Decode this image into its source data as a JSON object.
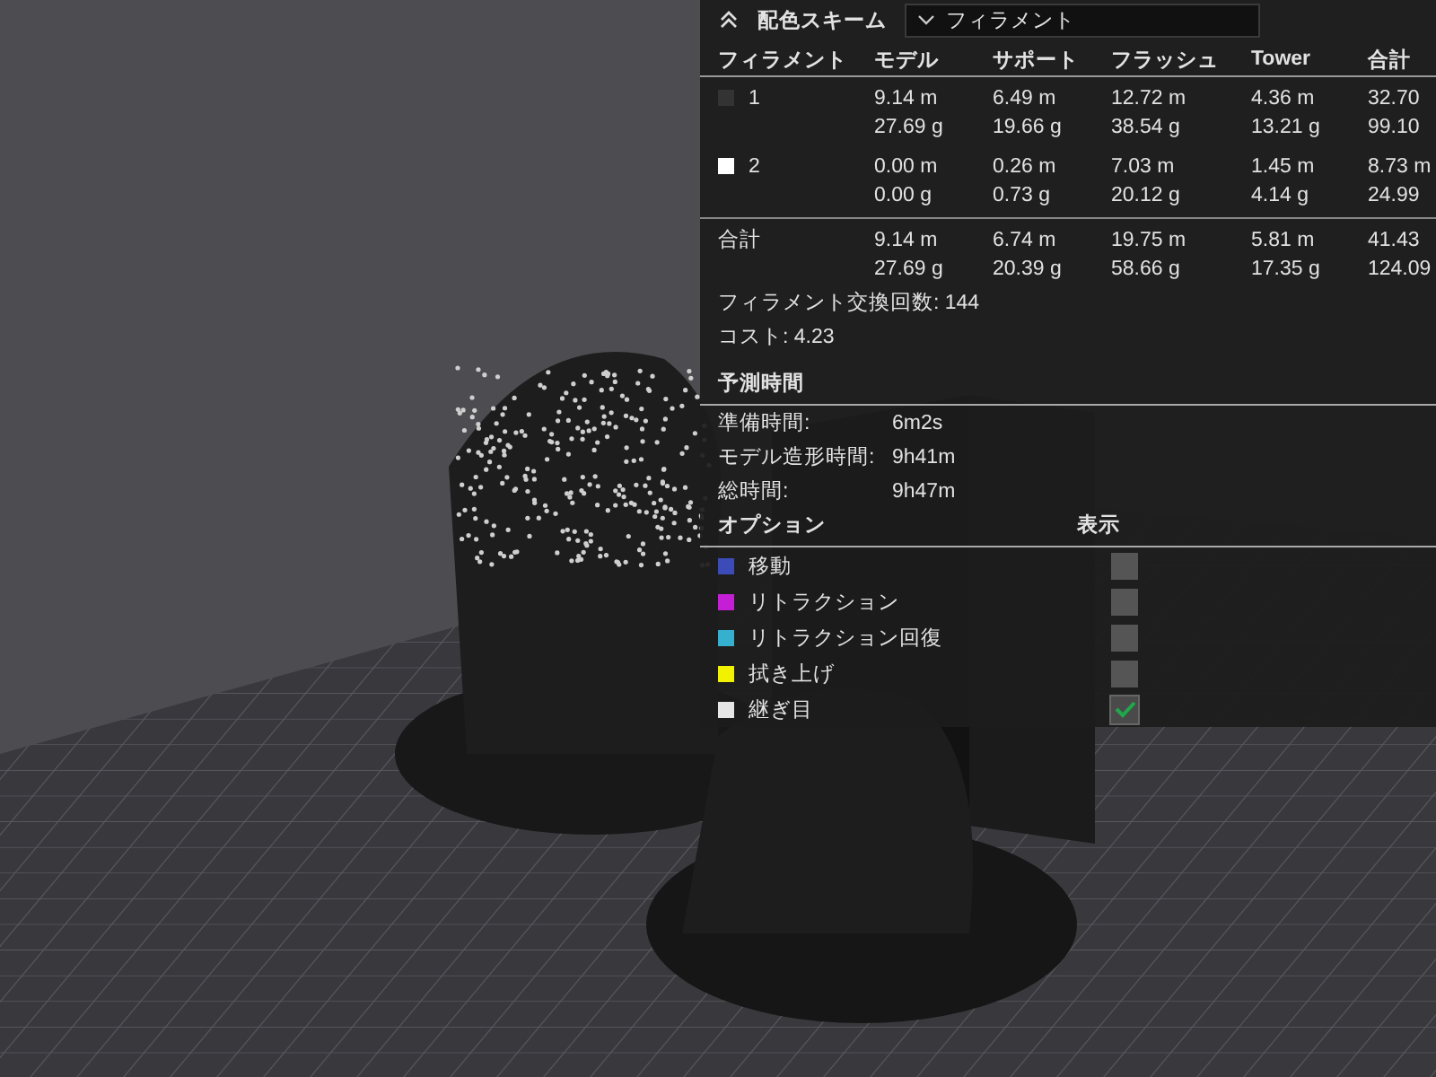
{
  "color_scheme": {
    "label": "配色スキーム",
    "dropdown": "フィラメント"
  },
  "filament_table": {
    "columns": [
      "フィラメント",
      "モデル",
      "サポート",
      "フラッシュ",
      "Tower",
      "合計"
    ],
    "rows": [
      {
        "name": "1",
        "color": "#333333",
        "values": [
          [
            "9.14 m",
            "27.69 g"
          ],
          [
            "6.49 m",
            "19.66 g"
          ],
          [
            "12.72 m",
            "38.54 g"
          ],
          [
            "4.36 m",
            "13.21 g"
          ],
          [
            "32.70",
            "99.10"
          ]
        ]
      },
      {
        "name": "2",
        "color": "#ffffff",
        "values": [
          [
            "0.00 m",
            "0.00 g"
          ],
          [
            "0.26 m",
            "0.73 g"
          ],
          [
            "7.03 m",
            "20.12 g"
          ],
          [
            "1.45 m",
            "4.14 g"
          ],
          [
            "8.73 m",
            "24.99"
          ]
        ]
      }
    ],
    "total": {
      "label": "合計",
      "values": [
        [
          "9.14 m",
          "27.69 g"
        ],
        [
          "6.74 m",
          "20.39 g"
        ],
        [
          "19.75 m",
          "58.66 g"
        ],
        [
          "5.81 m",
          "17.35 g"
        ],
        [
          "41.43",
          "124.09"
        ]
      ]
    }
  },
  "summary": [
    {
      "label": "フィラメント交換回数:",
      "value": "144"
    },
    {
      "label": "コスト:",
      "value": "4.23"
    }
  ],
  "estimated_time": {
    "title": "予測時間",
    "rows": [
      {
        "label": "準備時間:",
        "value": "6m2s"
      },
      {
        "label": "モデル造形時間:",
        "value": "9h41m"
      },
      {
        "label": "総時間:",
        "value": "9h47m"
      }
    ]
  },
  "options": {
    "title": "オプション",
    "show_header": "表示",
    "items": [
      {
        "label": "移動",
        "color": "#3b4cb8",
        "checked": false
      },
      {
        "label": "リトラクション",
        "color": "#c41fd4",
        "checked": false
      },
      {
        "label": "リトラクション回復",
        "color": "#35b1cf",
        "checked": false
      },
      {
        "label": "拭き上げ",
        "color": "#f2f200",
        "checked": false
      },
      {
        "label": "継ぎ目",
        "color": "#e6e6e6",
        "checked": true
      }
    ]
  }
}
